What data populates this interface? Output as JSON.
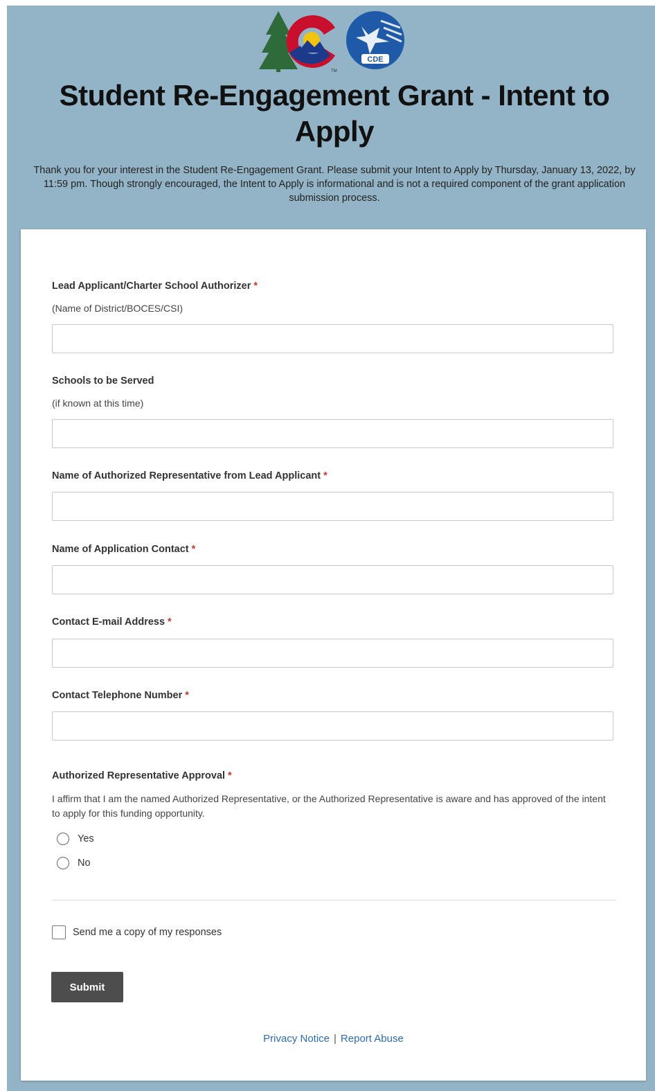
{
  "header": {
    "title": "Student Re-Engagement Grant - Intent to Apply",
    "intro": "Thank you for your interest in the Student Re-Engagement Grant. Please submit your Intent to Apply by Thursday, January 13, 2022, by 11:59 pm. Though strongly encouraged, the Intent to Apply is informational and is not a required component of the grant application submission process.",
    "logo_badge_text": "CDE",
    "logo_mark": "TM"
  },
  "form": {
    "required_mark": "*",
    "fields": [
      {
        "label": "Lead Applicant/Charter School Authorizer",
        "hint": "(Name of District/BOCES/CSI)",
        "value": ""
      },
      {
        "label": "Schools to be Served",
        "hint": "(if known at this time)",
        "value": ""
      },
      {
        "label": "Name of Authorized Representative from Lead Applicant",
        "value": ""
      },
      {
        "label": "Name of Application Contact",
        "value": ""
      },
      {
        "label": "Contact E-mail Address",
        "value": ""
      },
      {
        "label": "Contact Telephone Number",
        "value": ""
      }
    ],
    "approval": {
      "label": "Authorized Representative Approval",
      "description": "I affirm that I am the named Authorized Representative, or the Authorized Representative is aware and has approved of the intent to apply for this funding opportunity.",
      "options": [
        "Yes",
        "No"
      ]
    },
    "copy_label": "Send me a copy of my responses",
    "submit_label": "Submit"
  },
  "footer": {
    "privacy": "Privacy Notice",
    "separator": "|",
    "report": "Report Abuse"
  },
  "colors": {
    "background": "#93b4c6",
    "submit": "#4d4d4d",
    "link": "#2b6cb0",
    "required": "#c0392b"
  }
}
